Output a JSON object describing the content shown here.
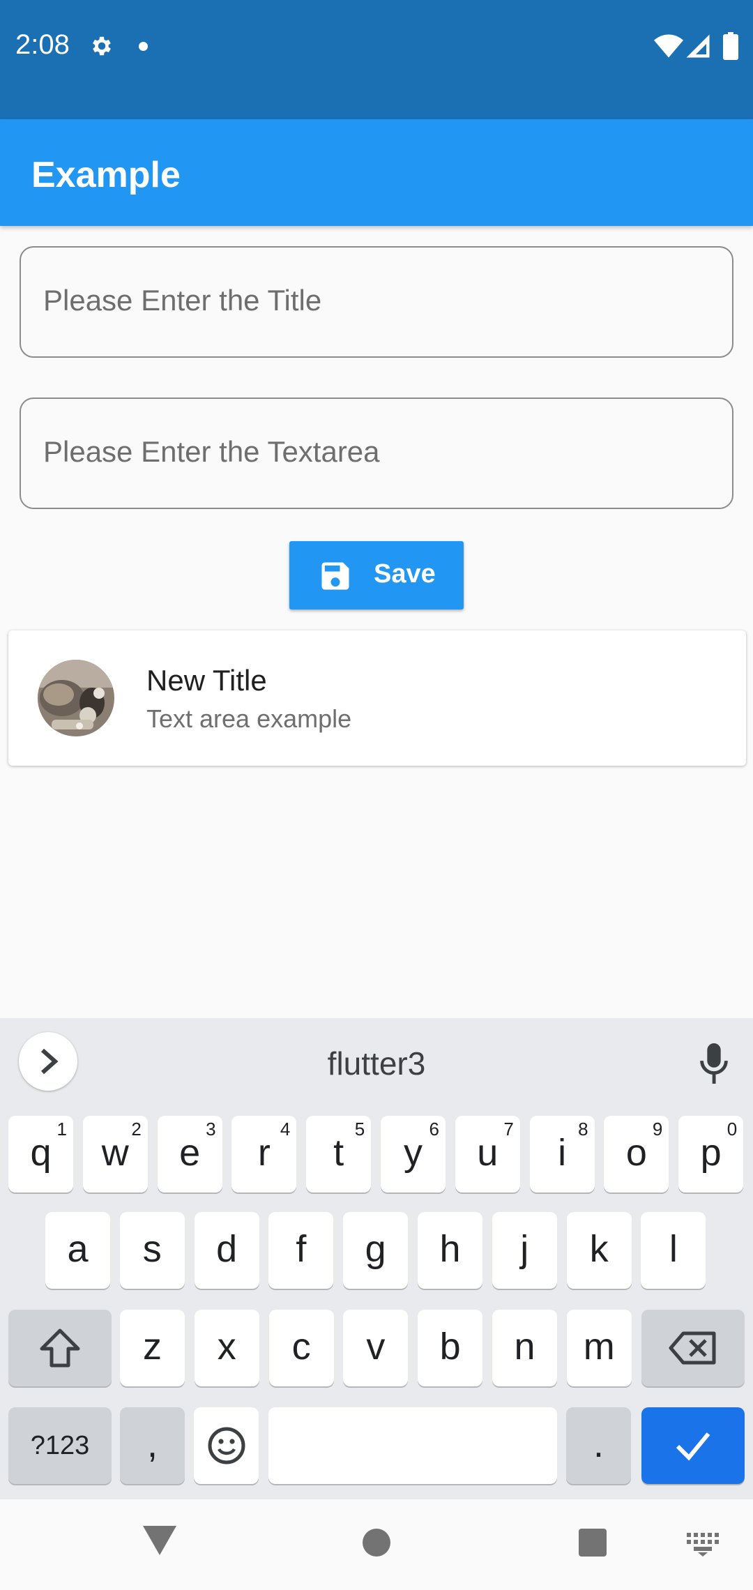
{
  "status_bar": {
    "time": "2:08"
  },
  "app_bar": {
    "title": "Example"
  },
  "form": {
    "title_placeholder": "Please Enter the Title",
    "textarea_placeholder": "Please Enter the Textarea",
    "save_label": "Save"
  },
  "list": {
    "items": [
      {
        "title": "New Title",
        "subtitle": "Text area example"
      }
    ]
  },
  "keyboard": {
    "suggestion": "flutter3",
    "row1": [
      {
        "ch": "q",
        "hint": "1"
      },
      {
        "ch": "w",
        "hint": "2"
      },
      {
        "ch": "e",
        "hint": "3"
      },
      {
        "ch": "r",
        "hint": "4"
      },
      {
        "ch": "t",
        "hint": "5"
      },
      {
        "ch": "y",
        "hint": "6"
      },
      {
        "ch": "u",
        "hint": "7"
      },
      {
        "ch": "i",
        "hint": "8"
      },
      {
        "ch": "o",
        "hint": "9"
      },
      {
        "ch": "p",
        "hint": "0"
      }
    ],
    "row2": [
      "a",
      "s",
      "d",
      "f",
      "g",
      "h",
      "j",
      "k",
      "l"
    ],
    "row3": [
      "z",
      "x",
      "c",
      "v",
      "b",
      "n",
      "m"
    ],
    "symbols_label": "?123",
    "comma_label": ",",
    "period_label": "."
  },
  "colors": {
    "status_bar": "#1b6fb3",
    "app_bar": "#2196f3",
    "enter_key": "#1a73e8"
  }
}
